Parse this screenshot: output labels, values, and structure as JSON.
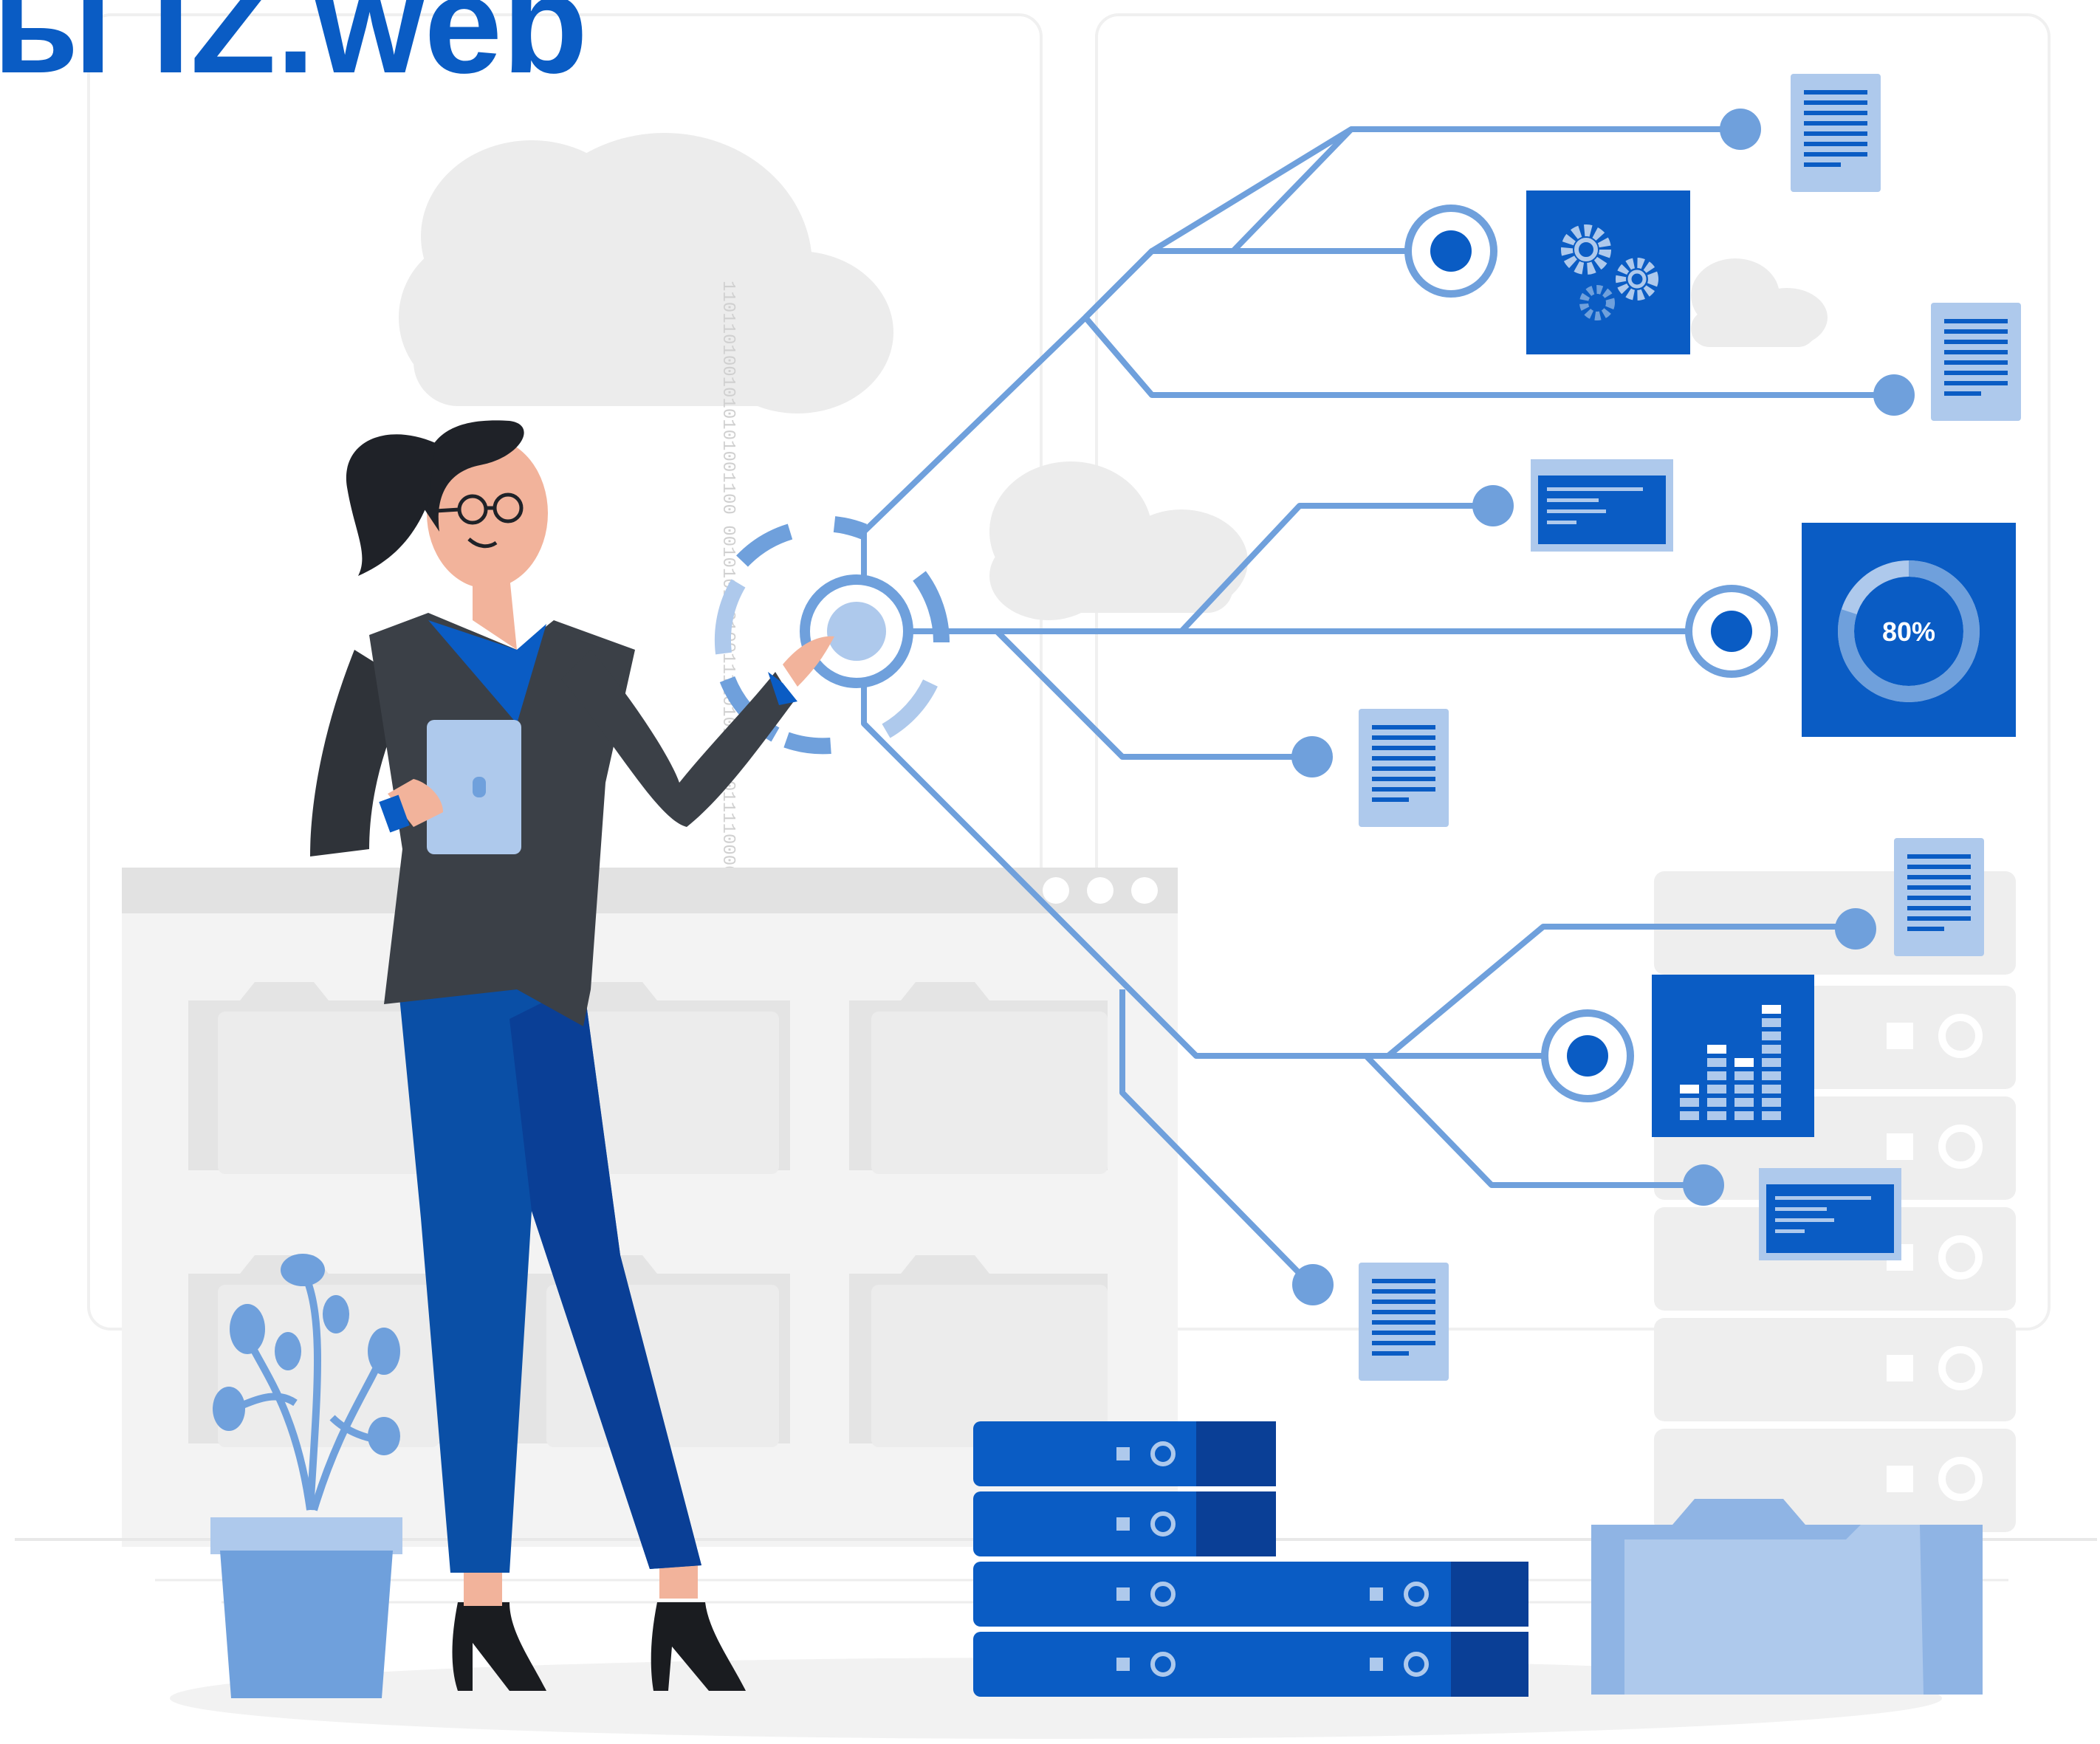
{
  "title": "ы IZ.web",
  "donut": {
    "label": "80%",
    "value": 0.8
  },
  "binary_text": "1101101001010101001100 0010101101001111010101 1011110000001111110101 0101101011010101111101",
  "colors": {
    "primary": "#0a5cc4",
    "light": "#6fa0dc",
    "pale": "#aec9ec",
    "dark_blue": "#0a3f96",
    "grey": "#ececec",
    "grey_dark": "#d9d9d9",
    "jacket": "#3b4047",
    "skin": "#f2b39b"
  },
  "icons": {
    "gears": "gears-icon",
    "document": "document-icon",
    "window": "code-window-icon",
    "bars": "bar-chart-icon"
  }
}
